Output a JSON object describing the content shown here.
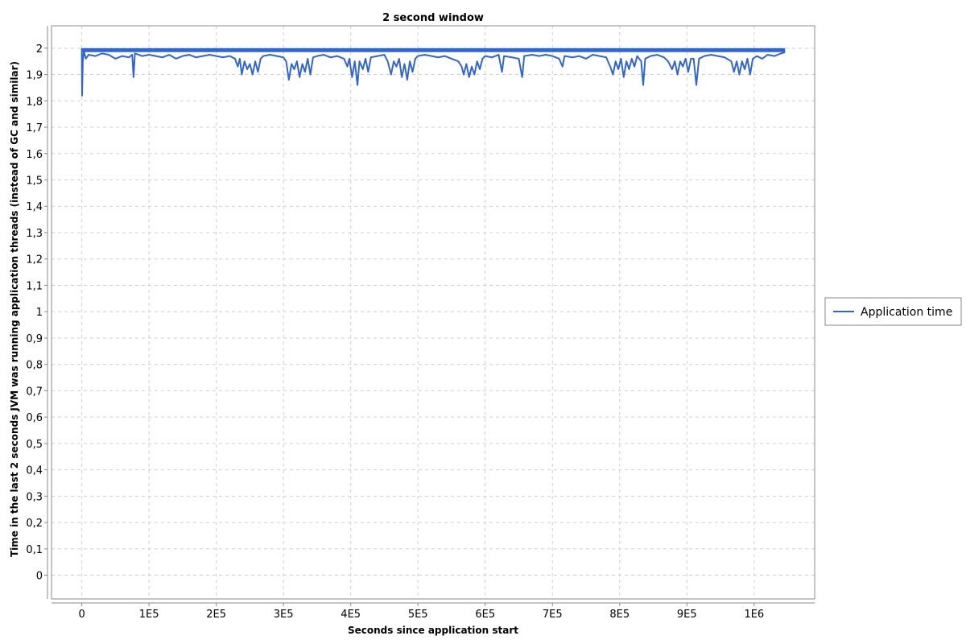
{
  "chart_data": {
    "type": "line",
    "title": "2 second window",
    "xlabel": "Seconds since application start",
    "ylabel": "Time in the last 2 seconds JVM was running application threads (instead of GC and similar)",
    "xlim": [
      -45000,
      1090000
    ],
    "ylim": [
      -0.09,
      2.085
    ],
    "x_ticks": [
      0,
      100000,
      200000,
      300000,
      400000,
      500000,
      600000,
      700000,
      800000,
      900000,
      1000000
    ],
    "x_tick_labels": [
      "0",
      "1E5",
      "2E5",
      "3E5",
      "4E5",
      "5E5",
      "6E5",
      "7E5",
      "8E5",
      "9E5",
      "1E6"
    ],
    "y_ticks": [
      0,
      0.1,
      0.2,
      0.3,
      0.4,
      0.5,
      0.6,
      0.7,
      0.8,
      0.9,
      1,
      1.1,
      1.2,
      1.3,
      1.4,
      1.5,
      1.6,
      1.7,
      1.8,
      1.9,
      2
    ],
    "y_tick_labels": [
      "0",
      "0,1",
      "0,2",
      "0,3",
      "0,4",
      "0,5",
      "0,6",
      "0,7",
      "0,8",
      "0,9",
      "1",
      "1,1",
      "1,2",
      "1,3",
      "1,4",
      "1,5",
      "1,6",
      "1,7",
      "1,8",
      "1,9",
      "2"
    ],
    "grid": true,
    "legend_position": "right",
    "colors": {
      "series": "#3366cc",
      "plot_border": "#888888",
      "grid": "#d0d0d0"
    },
    "series": [
      {
        "name": "Application time",
        "color": "#3366cc",
        "points": [
          [
            0,
            2.0
          ],
          [
            500,
            1.82
          ],
          [
            1500,
            1.95
          ],
          [
            3000,
            1.99
          ],
          [
            6000,
            1.96
          ],
          [
            10000,
            1.975
          ],
          [
            20000,
            1.97
          ],
          [
            30000,
            1.98
          ],
          [
            40000,
            1.975
          ],
          [
            50000,
            1.96
          ],
          [
            60000,
            1.97
          ],
          [
            70000,
            1.965
          ],
          [
            75000,
            1.975
          ],
          [
            77000,
            1.89
          ],
          [
            79000,
            1.98
          ],
          [
            90000,
            1.97
          ],
          [
            100000,
            1.975
          ],
          [
            110000,
            1.97
          ],
          [
            120000,
            1.965
          ],
          [
            130000,
            1.975
          ],
          [
            140000,
            1.96
          ],
          [
            150000,
            1.97
          ],
          [
            160000,
            1.975
          ],
          [
            170000,
            1.965
          ],
          [
            180000,
            1.97
          ],
          [
            190000,
            1.975
          ],
          [
            200000,
            1.97
          ],
          [
            210000,
            1.965
          ],
          [
            220000,
            1.97
          ],
          [
            228000,
            1.96
          ],
          [
            232000,
            1.93
          ],
          [
            235000,
            1.96
          ],
          [
            238000,
            1.9
          ],
          [
            242000,
            1.95
          ],
          [
            246000,
            1.92
          ],
          [
            250000,
            1.94
          ],
          [
            254000,
            1.9
          ],
          [
            258000,
            1.95
          ],
          [
            262000,
            1.91
          ],
          [
            266000,
            1.96
          ],
          [
            270000,
            1.97
          ],
          [
            280000,
            1.975
          ],
          [
            290000,
            1.97
          ],
          [
            300000,
            1.965
          ],
          [
            304000,
            1.95
          ],
          [
            308000,
            1.88
          ],
          [
            312000,
            1.94
          ],
          [
            316000,
            1.92
          ],
          [
            320000,
            1.95
          ],
          [
            324000,
            1.89
          ],
          [
            328000,
            1.94
          ],
          [
            332000,
            1.91
          ],
          [
            336000,
            1.96
          ],
          [
            340000,
            1.9
          ],
          [
            344000,
            1.965
          ],
          [
            350000,
            1.97
          ],
          [
            360000,
            1.975
          ],
          [
            370000,
            1.965
          ],
          [
            380000,
            1.97
          ],
          [
            390000,
            1.96
          ],
          [
            395000,
            1.93
          ],
          [
            398000,
            1.96
          ],
          [
            402000,
            1.89
          ],
          [
            406000,
            1.95
          ],
          [
            410000,
            1.86
          ],
          [
            413000,
            1.95
          ],
          [
            418000,
            1.92
          ],
          [
            422000,
            1.96
          ],
          [
            426000,
            1.91
          ],
          [
            430000,
            1.965
          ],
          [
            440000,
            1.97
          ],
          [
            450000,
            1.975
          ],
          [
            455000,
            1.95
          ],
          [
            460000,
            1.9
          ],
          [
            464000,
            1.95
          ],
          [
            468000,
            1.93
          ],
          [
            472000,
            1.96
          ],
          [
            476000,
            1.89
          ],
          [
            480000,
            1.94
          ],
          [
            484000,
            1.88
          ],
          [
            488000,
            1.95
          ],
          [
            492000,
            1.91
          ],
          [
            496000,
            1.96
          ],
          [
            500000,
            1.97
          ],
          [
            510000,
            1.975
          ],
          [
            520000,
            1.97
          ],
          [
            530000,
            1.965
          ],
          [
            540000,
            1.97
          ],
          [
            550000,
            1.96
          ],
          [
            560000,
            1.95
          ],
          [
            565000,
            1.93
          ],
          [
            568000,
            1.9
          ],
          [
            572000,
            1.94
          ],
          [
            576000,
            1.89
          ],
          [
            580000,
            1.93
          ],
          [
            584000,
            1.9
          ],
          [
            588000,
            1.95
          ],
          [
            592000,
            1.92
          ],
          [
            596000,
            1.96
          ],
          [
            600000,
            1.97
          ],
          [
            610000,
            1.965
          ],
          [
            620000,
            1.975
          ],
          [
            625000,
            1.91
          ],
          [
            628000,
            1.97
          ],
          [
            640000,
            1.965
          ],
          [
            650000,
            1.96
          ],
          [
            655000,
            1.89
          ],
          [
            658000,
            1.97
          ],
          [
            670000,
            1.975
          ],
          [
            680000,
            1.97
          ],
          [
            690000,
            1.975
          ],
          [
            700000,
            1.97
          ],
          [
            710000,
            1.96
          ],
          [
            715000,
            1.93
          ],
          [
            718000,
            1.97
          ],
          [
            730000,
            1.965
          ],
          [
            740000,
            1.97
          ],
          [
            750000,
            1.96
          ],
          [
            760000,
            1.975
          ],
          [
            770000,
            1.97
          ],
          [
            780000,
            1.965
          ],
          [
            786000,
            1.93
          ],
          [
            790000,
            1.9
          ],
          [
            794000,
            1.95
          ],
          [
            798000,
            1.92
          ],
          [
            802000,
            1.96
          ],
          [
            806000,
            1.89
          ],
          [
            810000,
            1.95
          ],
          [
            814000,
            1.92
          ],
          [
            818000,
            1.96
          ],
          [
            822000,
            1.93
          ],
          [
            826000,
            1.97
          ],
          [
            832000,
            1.95
          ],
          [
            835000,
            1.86
          ],
          [
            838000,
            1.96
          ],
          [
            846000,
            1.97
          ],
          [
            856000,
            1.975
          ],
          [
            866000,
            1.965
          ],
          [
            872000,
            1.95
          ],
          [
            878000,
            1.92
          ],
          [
            882000,
            1.95
          ],
          [
            886000,
            1.9
          ],
          [
            890000,
            1.95
          ],
          [
            894000,
            1.93
          ],
          [
            898000,
            1.96
          ],
          [
            902000,
            1.91
          ],
          [
            906000,
            1.96
          ],
          [
            910000,
            1.96
          ],
          [
            914000,
            1.86
          ],
          [
            918000,
            1.96
          ],
          [
            926000,
            1.97
          ],
          [
            936000,
            1.975
          ],
          [
            946000,
            1.97
          ],
          [
            956000,
            1.965
          ],
          [
            966000,
            1.95
          ],
          [
            970000,
            1.91
          ],
          [
            974000,
            1.95
          ],
          [
            978000,
            1.9
          ],
          [
            982000,
            1.95
          ],
          [
            986000,
            1.92
          ],
          [
            990000,
            1.96
          ],
          [
            994000,
            1.9
          ],
          [
            998000,
            1.96
          ],
          [
            1004000,
            1.97
          ],
          [
            1012000,
            1.96
          ],
          [
            1020000,
            1.975
          ],
          [
            1030000,
            1.97
          ],
          [
            1040000,
            1.98
          ],
          [
            1046000,
            1.985
          ]
        ]
      }
    ]
  }
}
